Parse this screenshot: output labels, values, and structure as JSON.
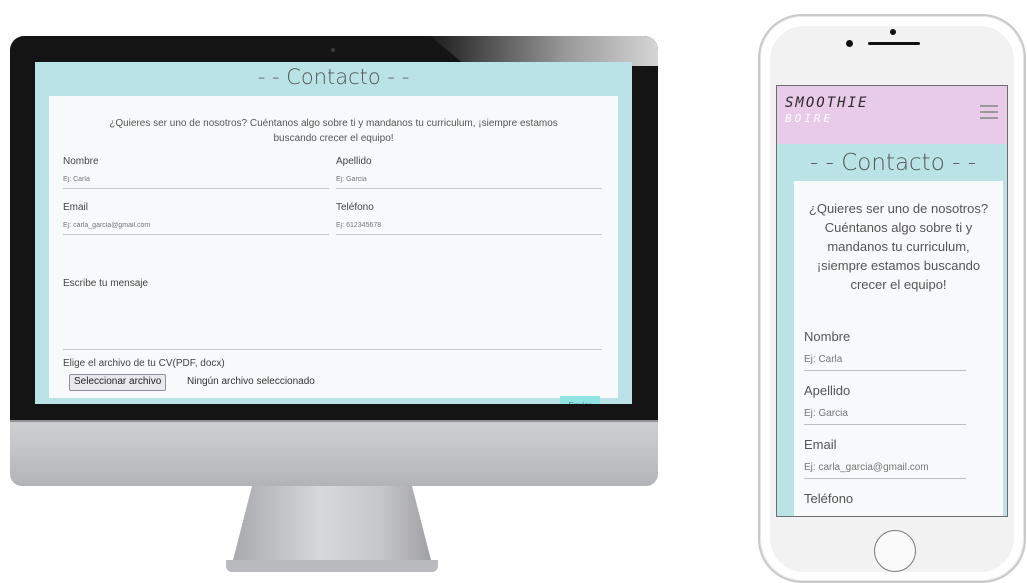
{
  "desktop": {
    "page_title": "- - Contacto - -",
    "intro": "¿Quieres ser uno de nosotros? Cuéntanos algo sobre ti y mandanos tu curriculum, ¡siempre estamos buscando crecer el equipo!",
    "fields": {
      "nombre": {
        "label": "Nombre",
        "placeholder": "Ej: Carla"
      },
      "apellido": {
        "label": "Apellido",
        "placeholder": "Ej: Garcia"
      },
      "email": {
        "label": "Email",
        "placeholder": "Ej: carla_garcia@gmail.com"
      },
      "telefono": {
        "label": "Teléfono",
        "placeholder": "Ej: 612345678"
      }
    },
    "message_label": "Escribe tu mensaje",
    "file_label": "Elige el archivo de tu CV(PDF, docx)",
    "file_button": "Seleccionar archivo",
    "file_status": "Ningún archivo seleccionado",
    "send_button": "Enviar"
  },
  "mobile": {
    "logo_line1": "SMOOTHIE",
    "logo_line2": "BOIRE",
    "menu_icon": "hamburger-icon",
    "page_title": "- - Contacto - -",
    "intro": "¿Quieres ser uno de nosotros? Cuéntanos algo sobre ti y mandanos tu curriculum, ¡siempre estamos buscando crecer el equipo!",
    "fields": {
      "nombre": {
        "label": "Nombre",
        "placeholder": "Ej: Carla"
      },
      "apellido": {
        "label": "Apellido",
        "placeholder": "Ej: Garcia"
      },
      "email": {
        "label": "Email",
        "placeholder": "Ej: carla_garcia@gmail.com"
      },
      "telefono": {
        "label": "Teléfono"
      }
    }
  },
  "colors": {
    "page_background": "#b9e3e6",
    "card_background": "#f8f9fa",
    "header_pink": "#e8cbe9",
    "send_button": "#8fe3e0"
  }
}
